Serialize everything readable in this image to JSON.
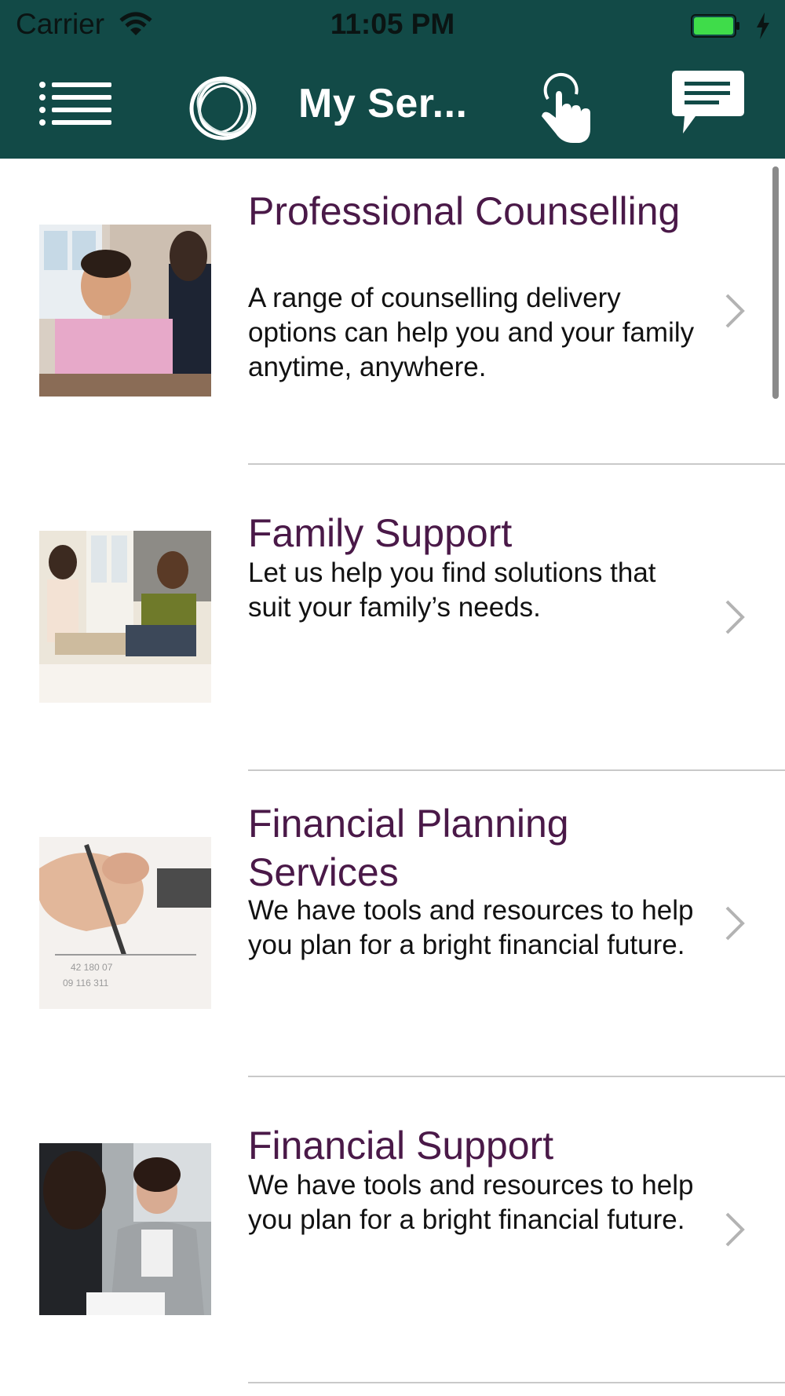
{
  "status_bar": {
    "carrier": "Carrier",
    "time": "11:05 PM",
    "battery_color": "#3fdc4a"
  },
  "navbar": {
    "title": "My Ser...",
    "background": "#124a47",
    "icons": [
      "menu-icon",
      "logo-rings-icon",
      "touch-hand-icon",
      "chat-bubble-icon"
    ]
  },
  "services": [
    {
      "title": "Professional Counselling",
      "description": "A range of counselling delivery options can help you and your family anytime, anywhere."
    },
    {
      "title": "Family Support",
      "description": "Let us help you find solutions that suit your family’s needs."
    },
    {
      "title": "Financial Planning Services",
      "description": "We have tools and resources to help you plan for a bright financial future."
    },
    {
      "title": "Financial Support",
      "description": "We have tools and resources to help you plan for a bright financial future."
    }
  ],
  "colors": {
    "title": "#4a1948",
    "description": "#121212",
    "chevron": "#b3b3b3",
    "separator": "#c9c9c9"
  }
}
